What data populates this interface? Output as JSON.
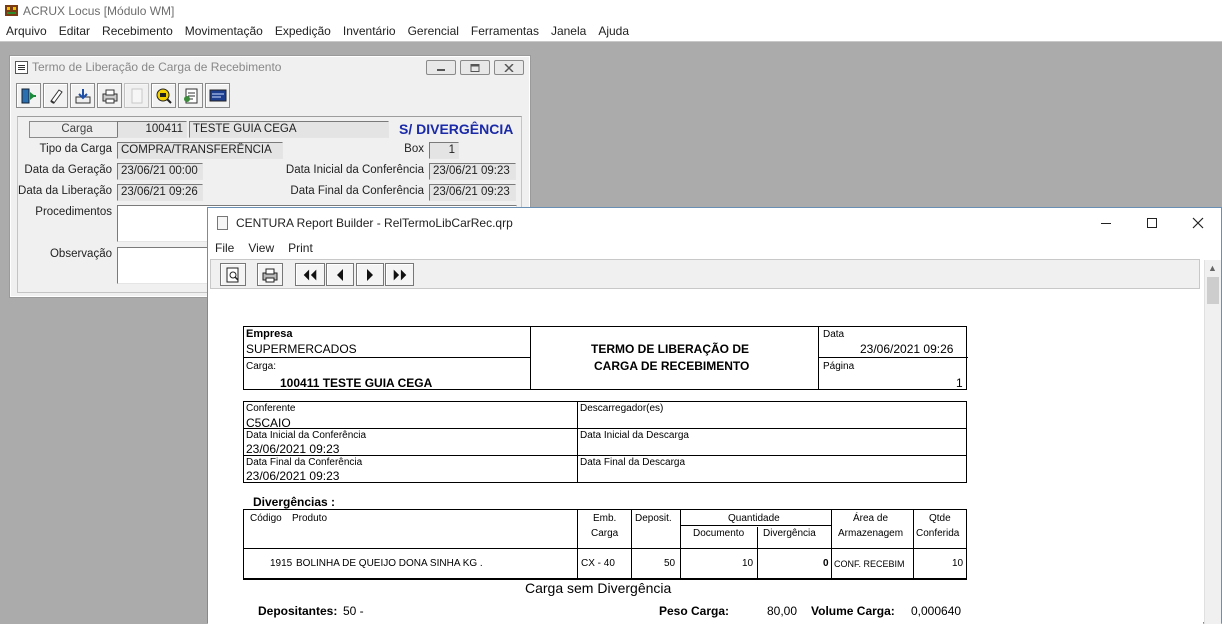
{
  "app": {
    "title": "ACRUX Locus [Módulo WM]",
    "menu": [
      "Arquivo",
      "Editar",
      "Recebimento",
      "Movimentação",
      "Expedição",
      "Inventário",
      "Gerencial",
      "Ferramentas",
      "Janela",
      "Ajuda"
    ]
  },
  "termo_window": {
    "title": "Termo de Liberação de Carga de Recebimento",
    "carga_label": "Carga",
    "carga_code": "100411",
    "carga_name": "TESTE GUIA CEGA",
    "status": "S/ DIVERGÊNCIA",
    "tipo_label": "Tipo da Carga",
    "tipo_value": "COMPRA/TRANSFERÊNCIA",
    "box_label": "Box",
    "box_value": "1",
    "geracao_label": "Data da Geração",
    "geracao_value": "23/06/21  00:00",
    "ini_conf_label": "Data Inicial da Conferência",
    "ini_conf_value": "23/06/21  09:23",
    "liberacao_label": "Data da Liberação",
    "liberacao_value": "23/06/21  09:26",
    "fim_conf_label": "Data Final da Conferência",
    "fim_conf_value": "23/06/21  09:23",
    "procedimentos_label": "Procedimentos",
    "observacao_label": "Observação"
  },
  "report_window": {
    "title": "CENTURA Report Builder - RelTermoLibCarRec.qrp",
    "menu": [
      "File",
      "View",
      "Print"
    ]
  },
  "report": {
    "empresa_label": "Empresa",
    "empresa_value": "SUPERMERCADOS",
    "carga_label": "Carga:",
    "carga_value": "100411 TESTE GUIA CEGA",
    "title_line1": "TERMO DE LIBERAÇÃO DE",
    "title_line2": "CARGA DE RECEBIMENTO",
    "data_label": "Data",
    "data_value": "23/06/2021  09:26",
    "pagina_label": "Página",
    "pagina_value": "1",
    "conferente_label": "Conferente",
    "conferente_value": "C5CAIO",
    "descarregador_label": "Descarregador(es)",
    "ini_conf_label": "Data Inicial da Conferência",
    "ini_conf_value": "23/06/2021 09:23",
    "ini_desc_label": "Data Inicial da Descarga",
    "fim_conf_label": "Data Final da Conferência",
    "fim_conf_value": "23/06/2021 09:23",
    "fim_desc_label": "Data Final da Descarga",
    "divergencias_label": "Divergências :",
    "col_codigo": "Código",
    "col_produto": "Produto",
    "col_emb_1": "Emb.",
    "col_emb_2": "Carga",
    "col_deposit": "Deposit.",
    "col_quantidade": "Quantidade",
    "col_documento": "Documento",
    "col_divergencia": "Divergência",
    "col_area_1": "Área de",
    "col_area_2": "Armazenagem",
    "col_qtde_1": "Qtde",
    "col_qtde_2": "Conferida",
    "row": {
      "codigo": "1915",
      "produto": "BOLINHA DE QUEIJO DONA SINHA KG .",
      "emb": "CX - 40",
      "deposit": "50",
      "documento": "10",
      "divergencia": "0",
      "area": "CONF. RECEBIM",
      "qtde": "10"
    },
    "sem_divergencia": "Carga sem Divergência",
    "depositantes_label": "Depositantes:",
    "depositantes_value": "50 -",
    "peso_label": "Peso Carga:",
    "peso_value": "80,00",
    "volume_label": "Volume Carga:",
    "volume_value": "0,000640"
  }
}
